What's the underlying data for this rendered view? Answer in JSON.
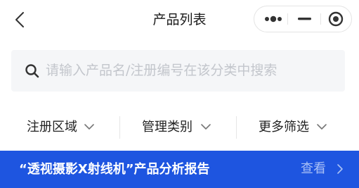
{
  "header": {
    "title": "产品列表"
  },
  "search": {
    "placeholder": "请输入产品名/注册编号在该分类中搜索"
  },
  "filters": [
    {
      "label": "注册区域"
    },
    {
      "label": "管理类别"
    },
    {
      "label": "更多筛选"
    }
  ],
  "banner": {
    "text": "“透视摄影X射线机”产品分析报告",
    "action": "查看"
  },
  "colors": {
    "accent": "#1e55e0",
    "search_bg": "#f5f6f8",
    "placeholder": "#c3c6cc",
    "view_text": "#a9c0f5"
  },
  "icons": {
    "back": "chevron-left-icon",
    "more": "more-dots-icon",
    "minimize": "minimize-icon",
    "close": "target-close-icon",
    "search": "search-icon",
    "dropdown": "chevron-down-icon",
    "banner_arrow": "chevron-right-icon"
  }
}
